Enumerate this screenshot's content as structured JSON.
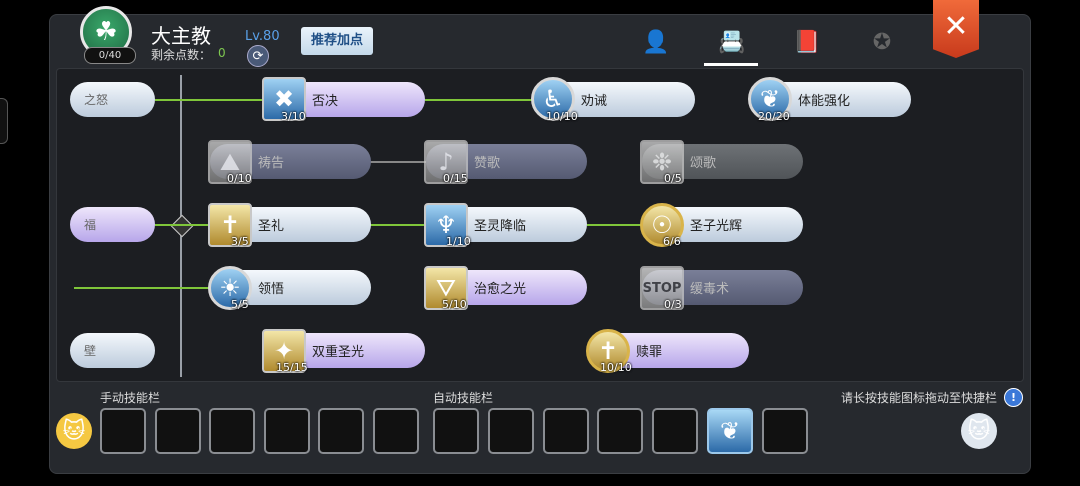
{
  "header": {
    "class_name": "大主教",
    "level": "Lv.80",
    "remaining_label": "剩余点数：",
    "remaining_value": "0",
    "points_badge": "0/40",
    "recommend_button": "推荐加点"
  },
  "tabs": [
    {
      "icon": "character-icon"
    },
    {
      "icon": "skill-book-icon",
      "active": true
    },
    {
      "icon": "book-icon"
    },
    {
      "icon": "emblem-icon"
    }
  ],
  "close_label": "✕",
  "edge_pills": [
    {
      "label": "之怒"
    },
    {
      "label": "福"
    },
    {
      "label": "壁"
    }
  ],
  "skills": [
    {
      "name": "否决",
      "count": "3/10",
      "icon": "cross-circle-icon"
    },
    {
      "name": "劝诫",
      "count": "10/10",
      "icon": "kneeling-figure-icon"
    },
    {
      "name": "体能强化",
      "count": "20/20",
      "icon": "body-aura-icon"
    },
    {
      "name": "祷告",
      "count": "0/10",
      "icon": "praying-hands-icon"
    },
    {
      "name": "赞歌",
      "count": "0/15",
      "icon": "music-note-icon"
    },
    {
      "name": "颂歌",
      "count": "0/5",
      "icon": "chorus-icon"
    },
    {
      "name": "圣礼",
      "count": "3/5",
      "icon": "holy-figure-icon"
    },
    {
      "name": "圣灵降临",
      "count": "1/10",
      "icon": "winged-spirit-icon"
    },
    {
      "name": "圣子光辉",
      "count": "6/6",
      "icon": "halo-figure-icon"
    },
    {
      "name": "领悟",
      "count": "5/5",
      "icon": "insight-bulb-icon"
    },
    {
      "name": "治愈之光",
      "count": "5/10",
      "icon": "light-beam-icon"
    },
    {
      "name": "缓毒术",
      "count": "0/3",
      "icon": "stop-sign-icon",
      "icon_text": "STOP"
    },
    {
      "name": "双重圣光",
      "count": "15/15",
      "icon": "twin-sparkle-icon"
    },
    {
      "name": "赎罪",
      "count": "10/10",
      "icon": "holy-cross-icon"
    }
  ],
  "bottom": {
    "manual_bar_label": "手动技能栏",
    "auto_bar_label": "自动技能栏",
    "hint": "请长按技能图标拖动至快捷栏",
    "info": "!"
  },
  "colors": {
    "link_green": "#7fc63a",
    "accent_blue": "#5aa0e8",
    "close_red": "#e0502a"
  }
}
